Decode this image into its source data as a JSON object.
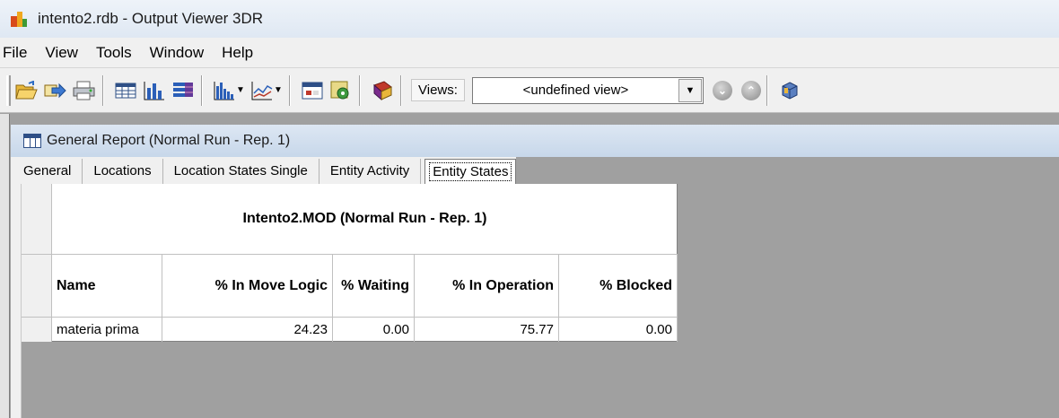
{
  "window": {
    "title": "intento2.rdb - Output Viewer 3DR"
  },
  "menu": [
    "File",
    "View",
    "Tools",
    "Window",
    "Help"
  ],
  "toolbar": {
    "icons": [
      "open-icon",
      "export-icon",
      "print-icon",
      "table-icon",
      "bar-chart-icon",
      "stacked-bar-icon",
      "histogram-icon",
      "line-chart-icon",
      "calendar-icon",
      "gear-icon",
      "book-icon",
      "previous-icon",
      "next-icon",
      "cube-icon"
    ],
    "views_label": "Views:",
    "views_value": "<undefined view>"
  },
  "report_window": {
    "title": "General Report (Normal Run - Rep. 1)",
    "tabs": [
      "General",
      "Locations",
      "Location States Single",
      "Entity Activity",
      "Entity States"
    ],
    "active_tab": "Entity States"
  },
  "report": {
    "title": "Intento2.MOD (Normal Run - Rep. 1)",
    "columns": [
      "Name",
      "% In Move Logic",
      "% Waiting",
      "% In Operation",
      "% Blocked"
    ],
    "rows": [
      [
        "materia prima",
        "24.23",
        "0.00",
        "75.77",
        "0.00"
      ]
    ]
  }
}
